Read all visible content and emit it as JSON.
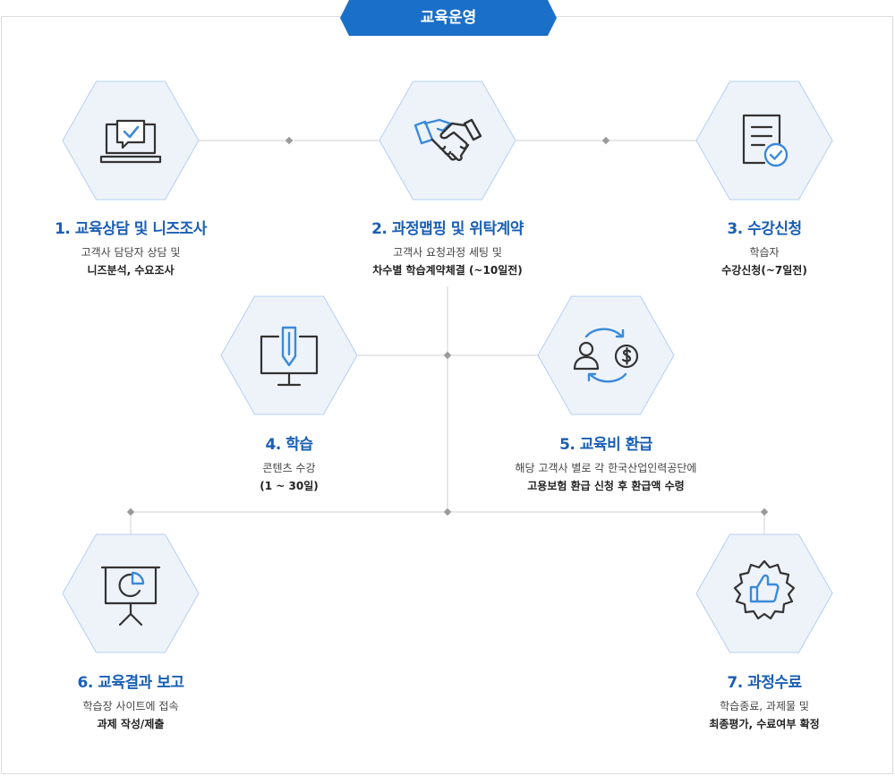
{
  "header": {
    "title": "교육운영"
  },
  "steps": [
    {
      "title": "1. 교육상담 및 니즈조사",
      "line1": "고객사 담당자 상담 및",
      "line2": "니즈분석, 수요조사",
      "icon": "laptop-chat-check-icon"
    },
    {
      "title": "2. 과정맵핑 및 위탁계약",
      "line1": "고객사 요청과정 세팅 및",
      "line2": "차수별 학습계약체결 (~10일전)",
      "icon": "handshake-icon"
    },
    {
      "title": "3. 수강신청",
      "line1": "학습자",
      "line2": "수강신청(~7일전)",
      "icon": "document-check-icon"
    },
    {
      "title": "4. 학습",
      "line1": "콘텐츠 수강",
      "line2": "(1 ~ 30일)",
      "icon": "monitor-pencil-icon"
    },
    {
      "title": "5. 교육비 환급",
      "line1": "해당 고객사 별로 각 한국산업인력공단에",
      "line2": "고용보험 환급 신청 후 환급액 수령",
      "icon": "refund-cycle-icon"
    },
    {
      "title": "6. 교육결과 보고",
      "line1": "학습장 사이트에 접속",
      "line2": "과제 작성/제출",
      "icon": "presentation-chart-icon"
    },
    {
      "title": "7. 과정수료",
      "line1": "학습종료, 과제물 및",
      "line2": "최종평가, 수료여부 확정",
      "icon": "thumbs-up-badge-icon"
    }
  ],
  "colors": {
    "accent": "#1a6fc9",
    "title": "#1a5fb4",
    "hex_fill": "#eef3fa",
    "hex_stroke": "#b5cff0",
    "icon_dark": "#333333",
    "icon_blue": "#3b8ad9",
    "connector": "#d0d0d0"
  }
}
